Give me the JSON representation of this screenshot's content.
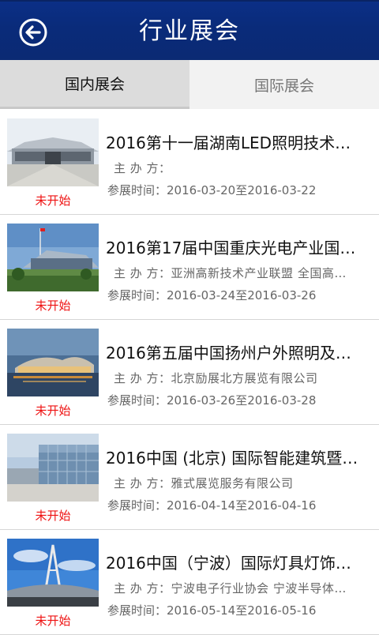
{
  "header": {
    "title": "行业展会",
    "back_icon": "back-arrow-icon"
  },
  "tabs": [
    {
      "label": "国内展会",
      "active": true
    },
    {
      "label": "国际展会",
      "active": false
    }
  ],
  "expos": [
    {
      "title": "2016第十一届湖南LED照明技术…",
      "organizer_label": "主 办 方：",
      "organizer": "",
      "dates_label": "参展时间：",
      "dates": "2016-03-20至2016-03-22",
      "status": "未开始"
    },
    {
      "title": "2016第17届中国重庆光电产业国…",
      "organizer_label": "主 办 方：",
      "organizer": "亚洲高新技术产业联盟 全国高…",
      "dates_label": "参展时间：",
      "dates": "2016-03-24至2016-03-26",
      "status": "未开始"
    },
    {
      "title": "2016第五届中国扬州户外照明及…",
      "organizer_label": "主 办 方：",
      "organizer": "北京励展北方展览有限公司",
      "dates_label": "参展时间：",
      "dates": "2016-03-26至2016-03-28",
      "status": "未开始"
    },
    {
      "title": "2016中国 (北京) 国际智能建筑暨…",
      "organizer_label": "主 办 方：",
      "organizer": "雅式展览服务有限公司",
      "dates_label": "参展时间：",
      "dates": "2016-04-14至2016-04-16",
      "status": "未开始"
    },
    {
      "title": "2016中国（宁波）国际灯具灯饰…",
      "organizer_label": "主 办 方：",
      "organizer": "宁波电子行业协会 宁波半导体…",
      "dates_label": "参展时间：",
      "dates": "2016-05-14至2016-05-16",
      "status": "未开始"
    }
  ],
  "colors": {
    "header_bg": "#0b2f86",
    "status_text": "#ee1111"
  }
}
